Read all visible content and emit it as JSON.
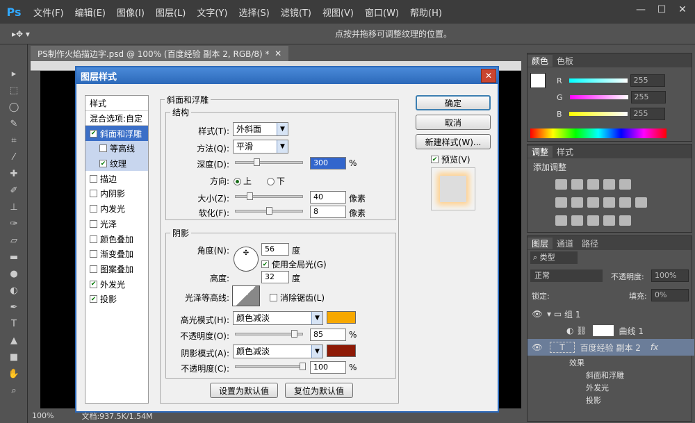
{
  "app": {
    "logo": "Ps",
    "menus": [
      "文件(F)",
      "编辑(E)",
      "图像(I)",
      "图层(L)",
      "文字(Y)",
      "选择(S)",
      "滤镜(T)",
      "视图(V)",
      "窗口(W)",
      "帮助(H)"
    ]
  },
  "options": {
    "hint": "点按并拖移可调整纹理的位置。"
  },
  "document": {
    "tab": "PS制作火焰描边字.psd @ 100% (百度经验 副本 2, RGB/8) *",
    "zoom": "100%",
    "doc_size": "文档:937.5K/1.54M"
  },
  "color_panel": {
    "tabs": [
      "颜色",
      "色板"
    ],
    "r_label": "R",
    "g_label": "G",
    "b_label": "B",
    "r": "255",
    "g": "255",
    "b": "255"
  },
  "adjust_panel": {
    "tabs": [
      "调整",
      "样式"
    ],
    "title": "添加调整"
  },
  "layers_panel": {
    "tabs": [
      "图层",
      "通道",
      "路径"
    ],
    "kind": "类型",
    "blend": "正常",
    "opacity_label": "不透明度:",
    "opacity": "100%",
    "lock_label": "锁定:",
    "fill_label": "填充:",
    "fill": "0%",
    "layers": [
      {
        "name": "组 1"
      },
      {
        "name": "曲线 1"
      },
      {
        "name": "百度经验 副本 2",
        "fx": "fx"
      },
      {
        "name": "效果"
      },
      {
        "name": "斜面和浮雕"
      },
      {
        "name": "外发光"
      },
      {
        "name": "投影"
      }
    ]
  },
  "dialog": {
    "title": "图层样式",
    "close": "✕",
    "styles": [
      {
        "label": "样式",
        "type": "hdr"
      },
      {
        "label": "混合选项:自定",
        "type": "hdr"
      },
      {
        "label": "斜面和浮雕",
        "checked": true,
        "type": "sel"
      },
      {
        "label": "等高线",
        "checked": false,
        "type": "sub"
      },
      {
        "label": "纹理",
        "checked": true,
        "type": "sub"
      },
      {
        "label": "描边",
        "checked": false
      },
      {
        "label": "内阴影",
        "checked": false
      },
      {
        "label": "内发光",
        "checked": false
      },
      {
        "label": "光泽",
        "checked": false
      },
      {
        "label": "颜色叠加",
        "checked": false
      },
      {
        "label": "渐变叠加",
        "checked": false
      },
      {
        "label": "图案叠加",
        "checked": false
      },
      {
        "label": "外发光",
        "checked": true
      },
      {
        "label": "投影",
        "checked": true
      }
    ],
    "bevel": {
      "title": "斜面和浮雕",
      "structure": "结构",
      "style_label": "样式(T):",
      "style": "外斜面",
      "technique_label": "方法(Q):",
      "technique": "平滑",
      "depth_label": "深度(D):",
      "depth": "300",
      "depth_unit": "%",
      "direction_label": "方向:",
      "dir_up": "上",
      "dir_down": "下",
      "size_label": "大小(Z):",
      "size": "40",
      "size_unit": "像素",
      "soften_label": "软化(F):",
      "soften": "8",
      "soften_unit": "像素"
    },
    "shading": {
      "title": "阴影",
      "angle_label": "角度(N):",
      "angle": "56",
      "angle_unit": "度",
      "global_light": "使用全局光(G)",
      "altitude_label": "高度:",
      "altitude": "32",
      "altitude_unit": "度",
      "gloss_label": "光泽等高线:",
      "anti_alias": "消除锯齿(L)",
      "highlight_label": "高光模式(H):",
      "highlight_mode": "颜色减淡",
      "highlight_color": "#f7a800",
      "hl_opacity_label": "不透明度(O):",
      "hl_opacity": "85",
      "pct": "%",
      "shadow_label": "阴影模式(A):",
      "shadow_mode": "颜色减淡",
      "shadow_color": "#8e1a06",
      "sh_opacity_label": "不透明度(C):",
      "sh_opacity": "100"
    },
    "buttons": {
      "default": "设置为默认值",
      "reset": "复位为默认值",
      "ok": "确定",
      "cancel": "取消",
      "new_style": "新建样式(W)...",
      "preview": "预览(V)"
    }
  }
}
